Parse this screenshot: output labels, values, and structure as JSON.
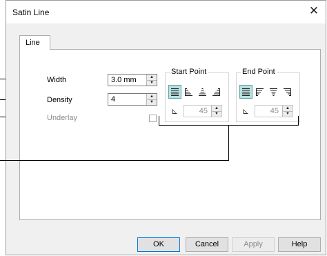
{
  "window": {
    "title": "Satin Line"
  },
  "tabs": [
    {
      "label": "Line"
    }
  ],
  "fields": {
    "width": {
      "label": "Width",
      "value": "3.0 mm"
    },
    "density": {
      "label": "Density",
      "value": "4"
    },
    "underlay": {
      "label": "Underlay",
      "checked": false
    }
  },
  "groups": {
    "start_point": {
      "label": "Start Point",
      "angle": "45",
      "selected_index": 0
    },
    "end_point": {
      "label": "End Point",
      "angle": "45",
      "selected_index": 0
    }
  },
  "buttons": {
    "ok": "OK",
    "cancel": "Cancel",
    "apply": "Apply",
    "help": "Help"
  },
  "colors": {
    "selected_fill": "#b8e0e0",
    "selected_border": "#56a3a3"
  },
  "icons": [
    "close-icon",
    "spin-up-icon",
    "spin-down-icon",
    "angle-icon",
    "end-shape-icon"
  ]
}
